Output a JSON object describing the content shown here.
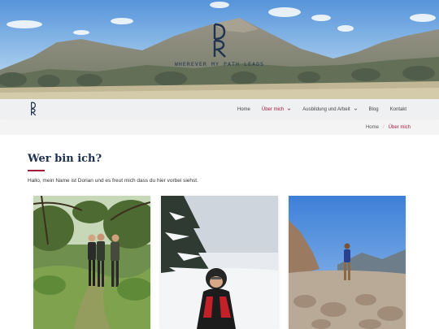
{
  "site": {
    "logo_alt": "DR monogram",
    "tagline": "WHEREVER MY PATH LEADS"
  },
  "nav": {
    "items": [
      {
        "label": "Home",
        "active": false,
        "has_dropdown": false
      },
      {
        "label": "Über mich",
        "active": true,
        "has_dropdown": true
      },
      {
        "label": "Ausbildung und Arbeit",
        "active": false,
        "has_dropdown": true
      },
      {
        "label": "Blog",
        "active": false,
        "has_dropdown": false
      },
      {
        "label": "Kontakt",
        "active": false,
        "has_dropdown": false
      }
    ]
  },
  "breadcrumb": {
    "home": "Home",
    "separator": "/",
    "current": "Über mich"
  },
  "main": {
    "title": "Wer bin ich?",
    "intro": "Hallo, mein Name ist Dorian und es freut mich dass du hier vorbei siehst."
  },
  "photos": [
    {
      "name": "forest-hike-photo",
      "description_icon": "hikers-in-forest"
    },
    {
      "name": "snow-child-photo",
      "description_icon": "child-in-snow"
    },
    {
      "name": "rocky-mountain-photo",
      "description_icon": "hiker-on-rocks"
    }
  ],
  "colors": {
    "accent": "#a11c3a",
    "navy": "#1c2f4f",
    "navbar_bg": "#eef0f2"
  }
}
